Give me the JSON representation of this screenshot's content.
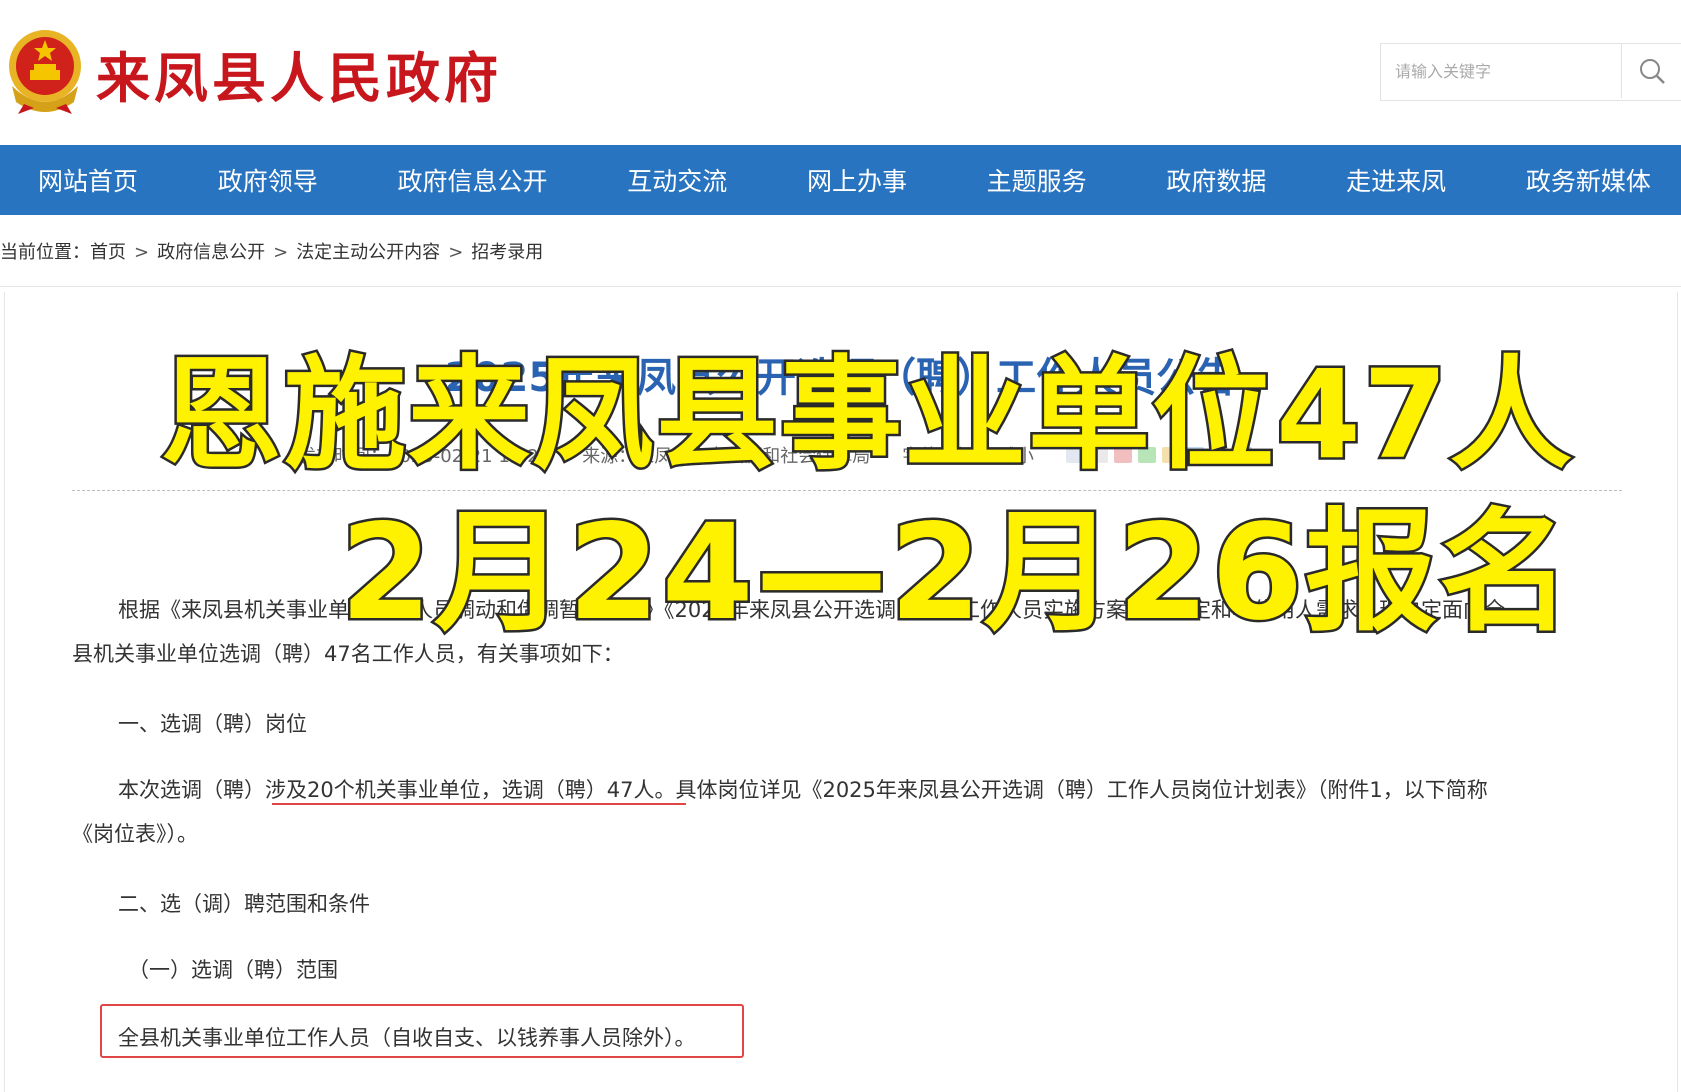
{
  "header": {
    "site_title": "来凤县人民政府",
    "search": {
      "placeholder": "请输入关键字",
      "icon": "search-icon"
    },
    "emblem": "national-emblem"
  },
  "nav": {
    "items": [
      "网站首页",
      "政府领导",
      "政府信息公开",
      "互动交流",
      "网上办事",
      "主题服务",
      "政府数据",
      "走进来凤",
      "政务新媒体"
    ],
    "color": "#2874c0"
  },
  "breadcrumb": {
    "prefix": "当前位置：",
    "items": [
      "首页",
      "政府信息公开",
      "法定主动公开内容",
      "招考录用"
    ],
    "separator": ">"
  },
  "article": {
    "title": "2025年来凤县公开选调（聘）工作人员公告",
    "meta": {
      "publish": "发布时间：2025-02-21 17:20",
      "source": "来源：来凤县人力资源和社会保障局",
      "font_label": "字体：",
      "font_larger": "加大",
      "font_smaller": "减小"
    },
    "p1_line1": "根据《来凤县机关事业单位工作人员调动和借调暂行办法》《2025年来凤县公开选调（聘）工作人员实施方案》的规定和单位用人需求，现决定面向全",
    "p1_line2": "县机关事业单位选调（聘）47名工作人员，有关事项如下：",
    "h1": "一、选调（聘）岗位",
    "p2_line1_pre": "本次选调（聘）",
    "p2_line1_hl": "涉及20个机关事业单位，选调（聘）47人",
    "p2_line1_post": "。具体岗位详见《2025年来凤县公开选调（聘）工作人员岗位计划表》（附件1，以下简称",
    "p2_line2": "《岗位表》）。",
    "h2": "二、选（调）聘范围和条件",
    "h3": "（一）选调（聘）范围",
    "p3": "全县机关事业单位工作人员（自收自支、以钱养事人员除外）。"
  },
  "overlay": {
    "line1": "恩施来凤县事业单位47人",
    "line2": "2月24—2月26报名",
    "color": "#fff200"
  },
  "colors": {
    "title_red": "#c8161d",
    "annotation_red": "#e04646",
    "article_title_blue": "#2b63b3"
  }
}
